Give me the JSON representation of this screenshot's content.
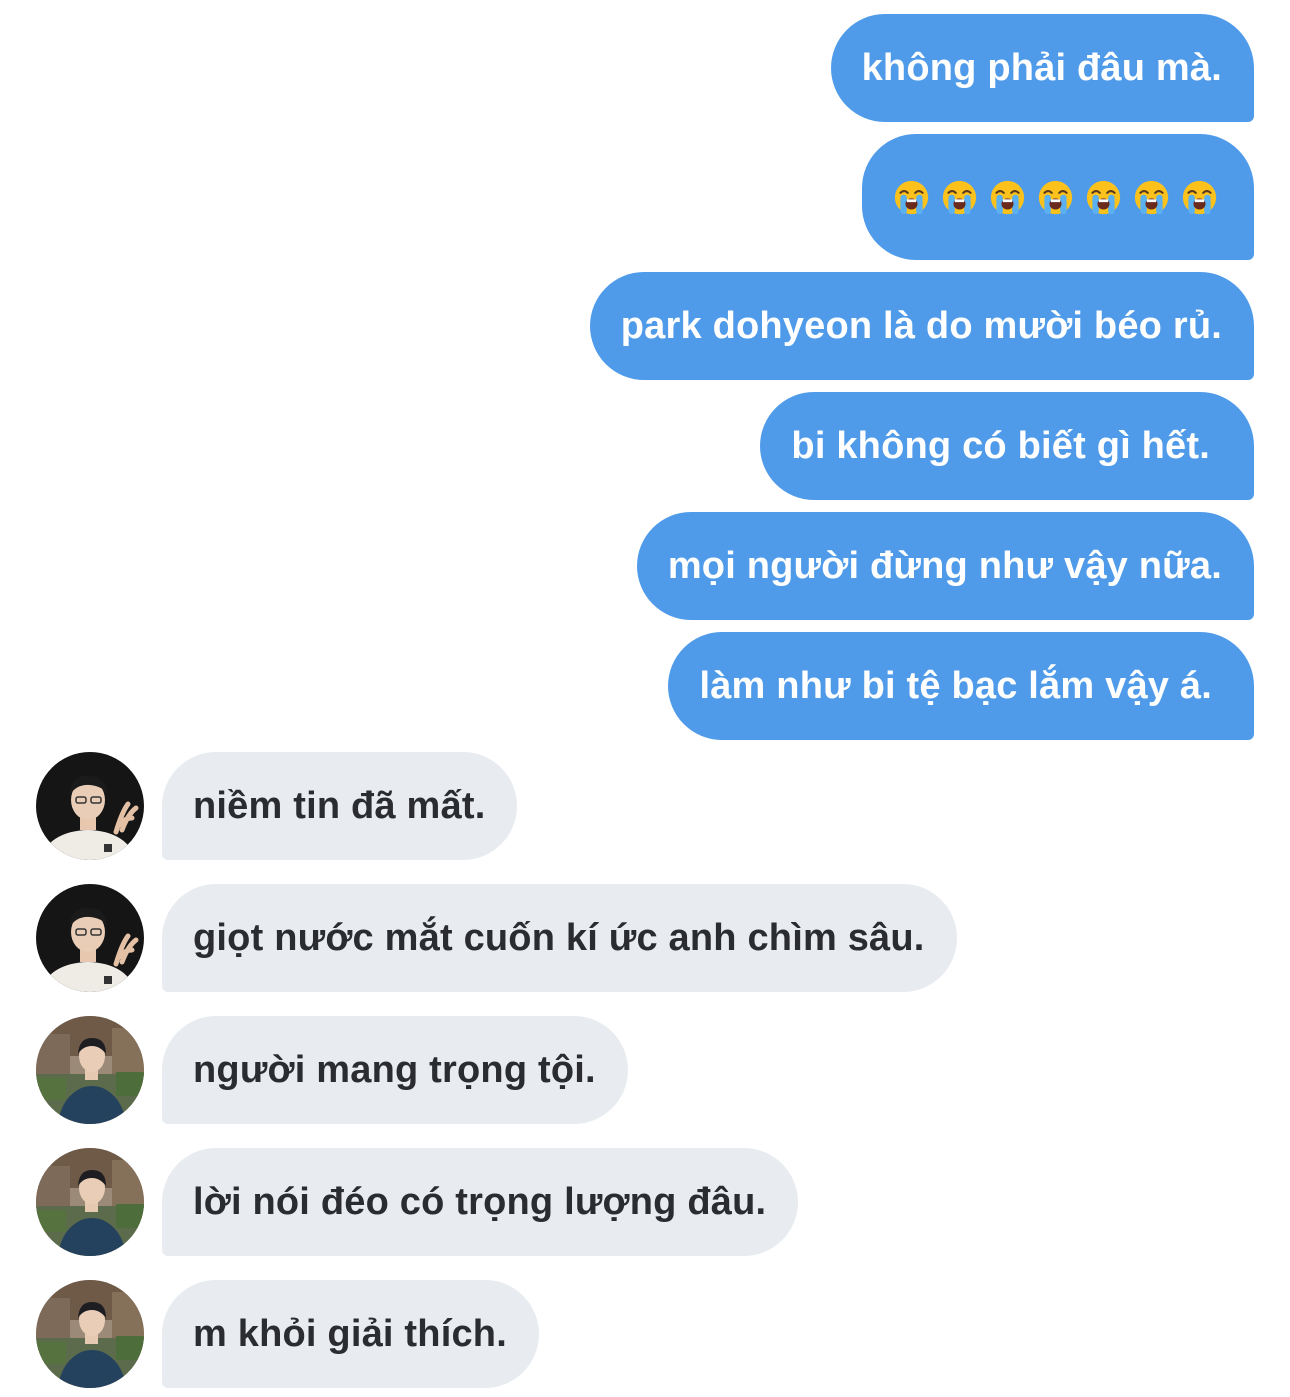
{
  "messages": {
    "outgoing": [
      {
        "text": "không phải đâu mà."
      },
      {
        "emoji": "loudly-crying-face",
        "count": 7
      },
      {
        "text": "park dohyeon là do mười béo rủ."
      },
      {
        "text": "bi không có biết gì hết."
      },
      {
        "text": "mọi người đừng như vậy nữa."
      },
      {
        "text": "làm như bi tệ bạc lắm vậy á."
      }
    ],
    "incoming": [
      {
        "text": "niềm tin đã mất.",
        "avatar": "avatar-user-dark-background"
      },
      {
        "text": "giọt nước mắt cuốn kí ức anh chìm sâu.",
        "avatar": "avatar-user-dark-background"
      },
      {
        "text": "người mang trọng tội.",
        "avatar": "avatar-user-street-background"
      },
      {
        "text": "lời nói đéo có trọng lượng đâu.",
        "avatar": "avatar-user-street-background"
      },
      {
        "text": "m khỏi giải thích.",
        "avatar": "avatar-user-street-background"
      }
    ]
  },
  "colors": {
    "outgoing_bubble": "#4f9bea",
    "outgoing_text": "#ffffff",
    "incoming_bubble": "#e8ebef",
    "incoming_text": "#2a2c30"
  }
}
